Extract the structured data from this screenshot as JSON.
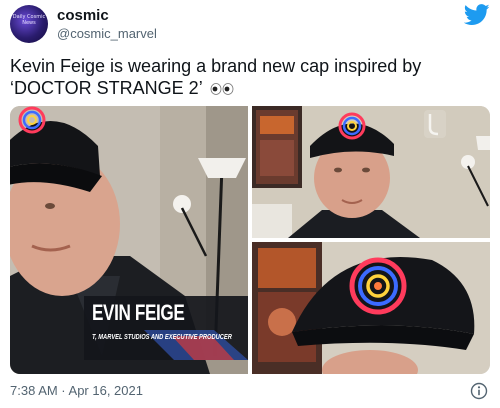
{
  "author": {
    "display_name": "cosmic",
    "handle": "@cosmic_marvel",
    "avatar_text": "Daily Cosmic News"
  },
  "tweet": {
    "text": "Kevin Feige is wearing a brand new cap inspired by ‘DOCTOR STRANGE 2’",
    "emoji_icon": "eyes-icon",
    "timestamp": "7:38 AM · Apr 16, 2021"
  },
  "media": {
    "lower_third_name": "EVIN FEIGE",
    "lower_third_title": "T, MARVEL STUDIOS AND EXECUTIVE PRODUCER"
  },
  "icons": {
    "brand": "twitter-bird-icon",
    "info": "info-icon"
  },
  "colors": {
    "brand_blue": "#1d9bf0",
    "text_primary": "#0f1419",
    "text_secondary": "#536471"
  }
}
